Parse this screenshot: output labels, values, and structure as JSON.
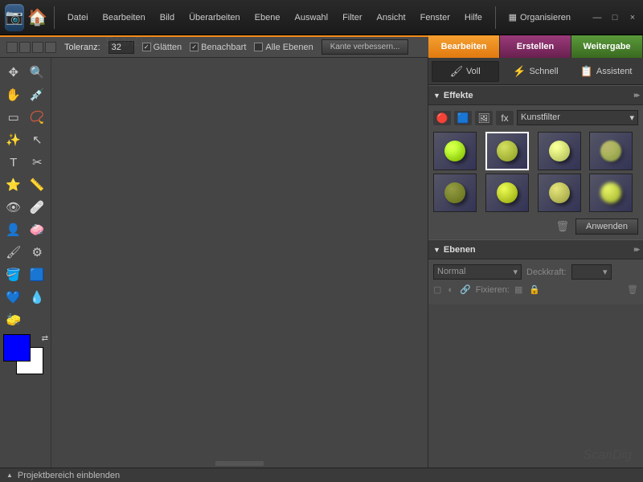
{
  "menubar": {
    "items": [
      "Datei",
      "Bearbeiten",
      "Bild",
      "Überarbeiten",
      "Ebene",
      "Auswahl",
      "Filter",
      "Ansicht",
      "Fenster",
      "Hilfe"
    ],
    "organize": "Organisieren"
  },
  "optbar": {
    "tolerance_label": "Toleranz:",
    "tolerance_value": "32",
    "smooth": "Glätten",
    "contiguous": "Benachbart",
    "all_layers": "Alle Ebenen",
    "refine_edge": "Kante verbessern..."
  },
  "tabs": {
    "edit": "Bearbeiten",
    "create": "Erstellen",
    "share": "Weitergabe"
  },
  "mode_tabs": {
    "full": "Voll",
    "quick": "Schnell",
    "guided": "Assistent"
  },
  "panels": {
    "effects_title": "Effekte",
    "effects_filter": "Kunstfilter",
    "apply": "Anwenden",
    "layers_title": "Ebenen",
    "blend_mode": "Normal",
    "opacity_label": "Deckkraft:",
    "lock_label": "Fixieren:"
  },
  "status": {
    "project": "Projektbereich einblenden"
  },
  "swatches": {
    "fg": "#0000ff",
    "bg": "#ffffff"
  },
  "watermark": "ScanDig"
}
